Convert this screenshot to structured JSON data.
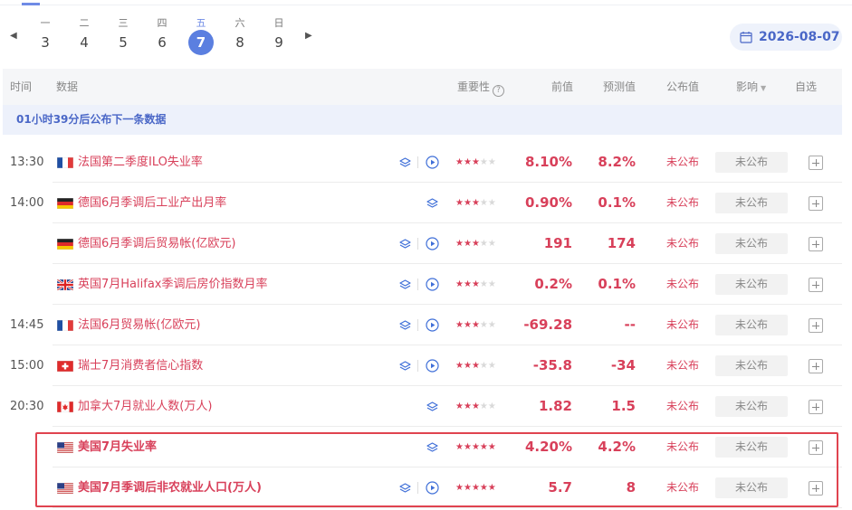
{
  "week": {
    "days": [
      {
        "weekday": "一",
        "date": "3"
      },
      {
        "weekday": "二",
        "date": "4"
      },
      {
        "weekday": "三",
        "date": "5"
      },
      {
        "weekday": "四",
        "date": "6"
      },
      {
        "weekday": "五",
        "date": "7"
      },
      {
        "weekday": "六",
        "date": "8"
      },
      {
        "weekday": "日",
        "date": "9"
      }
    ],
    "active_index": 4,
    "prev_arrow": "◀",
    "next_arrow": "▶"
  },
  "date_picker": {
    "value": "2026-08-07",
    "icon": "calendar-icon"
  },
  "table": {
    "headers": {
      "time": "时间",
      "data": "数据",
      "importance": "重要性",
      "previous": "前值",
      "forecast": "预测值",
      "actual": "公布值",
      "impact": "影响",
      "watch": "自选"
    },
    "countdown": "01小时39分后公布下一条数据",
    "rows": [
      {
        "time": "13:30",
        "flag": "FR",
        "name": "法国第二季度ILO失业率",
        "stars": 3,
        "previous": "8.10%",
        "forecast": "8.2%",
        "actual": "未公布",
        "impact": "未公布",
        "video": true,
        "bold": false
      },
      {
        "time": "14:00",
        "flag": "DE",
        "name": "德国6月季调后工业产出月率",
        "stars": 3,
        "previous": "0.90%",
        "forecast": "0.1%",
        "actual": "未公布",
        "impact": "未公布",
        "video": false,
        "bold": false
      },
      {
        "time": "",
        "flag": "DE",
        "name": "德国6月季调后贸易帐(亿欧元)",
        "stars": 3,
        "previous": "191",
        "forecast": "174",
        "actual": "未公布",
        "impact": "未公布",
        "video": true,
        "bold": false
      },
      {
        "time": "",
        "flag": "GB",
        "name": "英国7月Halifax季调后房价指数月率",
        "stars": 3,
        "previous": "0.2%",
        "forecast": "0.1%",
        "actual": "未公布",
        "impact": "未公布",
        "video": true,
        "bold": false
      },
      {
        "time": "14:45",
        "flag": "FR",
        "name": "法国6月贸易帐(亿欧元)",
        "stars": 3,
        "previous": "-69.28",
        "forecast": "--",
        "actual": "未公布",
        "impact": "未公布",
        "video": true,
        "bold": false
      },
      {
        "time": "15:00",
        "flag": "CH",
        "name": "瑞士7月消费者信心指数",
        "stars": 3,
        "previous": "-35.8",
        "forecast": "-34",
        "actual": "未公布",
        "impact": "未公布",
        "video": true,
        "bold": false
      },
      {
        "time": "20:30",
        "flag": "CA",
        "name": "加拿大7月就业人数(万人)",
        "stars": 3,
        "previous": "1.82",
        "forecast": "1.5",
        "actual": "未公布",
        "impact": "未公布",
        "video": false,
        "bold": false
      },
      {
        "time": "",
        "flag": "US",
        "name": "美国7月失业率",
        "stars": 5,
        "previous": "4.20%",
        "forecast": "4.2%",
        "actual": "未公布",
        "impact": "未公布",
        "video": false,
        "bold": true
      },
      {
        "time": "",
        "flag": "US",
        "name": "美国7月季调后非农就业人口(万人)",
        "stars": 5,
        "previous": "5.7",
        "forecast": "8",
        "actual": "未公布",
        "impact": "未公布",
        "video": true,
        "bold": true
      }
    ]
  },
  "colors": {
    "accent": "#5b7fe0",
    "value_red": "#d8405a",
    "highlight_border": "#e0434f",
    "header_bg": "#f5f6f8",
    "countdown_bg": "#edf1fb"
  }
}
